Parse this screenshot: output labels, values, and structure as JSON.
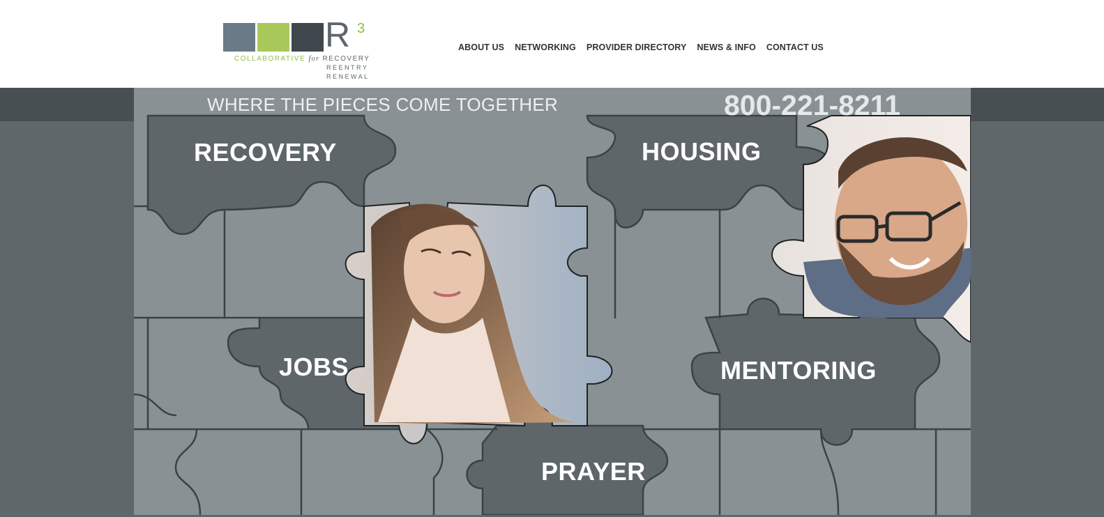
{
  "logo": {
    "letter": "R",
    "superscript": "3",
    "line1_a": "COLLABORATIVE",
    "line1_for": "for",
    "line1_b": "RECOVERY",
    "line2": "REENTRY",
    "line3": "RENEWAL",
    "colors": [
      "#6a7b87",
      "#a8c85a",
      "#40474c"
    ]
  },
  "nav": {
    "items": [
      "ABOUT US",
      "NETWORKING",
      "PROVIDER DIRECTORY",
      "NEWS & INFO",
      "CONTACT US"
    ]
  },
  "banner": {
    "tagline": "WHERE THE PIECES COME TOGETHER",
    "phone": "800-221-8211"
  },
  "pieces": {
    "recovery": "RECOVERY",
    "housing": "HOUSING",
    "jobs": "JOBS",
    "mentoring": "MENTORING",
    "prayer": "PRAYER"
  },
  "colors": {
    "band": "#474f53",
    "page_bg": "#5f676b",
    "piece_light": "#8a9195",
    "piece_dark": "#5e666a",
    "outline": "#3b4246"
  }
}
